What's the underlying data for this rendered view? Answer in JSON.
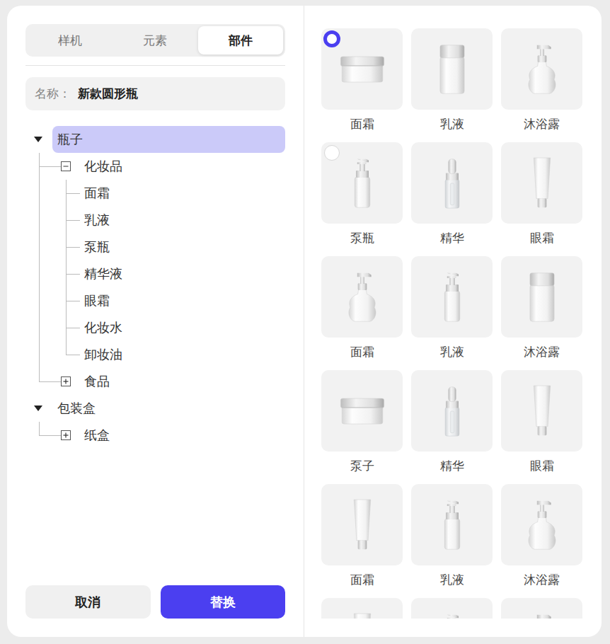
{
  "tabs": [
    {
      "label": "样机",
      "selected": false
    },
    {
      "label": "元素",
      "selected": false
    },
    {
      "label": "部件",
      "selected": true
    }
  ],
  "name_field": {
    "label": "名称：",
    "value": "新款圆形瓶"
  },
  "tree": [
    {
      "label": "瓶子",
      "kind": "group",
      "expanded": true,
      "selected": true,
      "children": [
        {
          "label": "化妆品",
          "kind": "folder",
          "expanded": true,
          "selected": false,
          "children": [
            {
              "label": "面霜",
              "kind": "leaf",
              "selected": false,
              "children": []
            },
            {
              "label": "乳液",
              "kind": "leaf",
              "selected": false,
              "children": []
            },
            {
              "label": "泵瓶",
              "kind": "leaf",
              "selected": false,
              "children": []
            },
            {
              "label": "精华液",
              "kind": "leaf",
              "selected": false,
              "children": []
            },
            {
              "label": "眼霜",
              "kind": "leaf",
              "selected": false,
              "children": []
            },
            {
              "label": "化妆水",
              "kind": "leaf",
              "selected": false,
              "children": []
            },
            {
              "label": "卸妆油",
              "kind": "leaf",
              "selected": false,
              "children": []
            }
          ]
        },
        {
          "label": "食品",
          "kind": "folder",
          "expanded": false,
          "selected": false,
          "children": []
        }
      ]
    },
    {
      "label": "包装盒",
      "kind": "group",
      "expanded": true,
      "selected": false,
      "children": [
        {
          "label": "纸盒",
          "kind": "folder",
          "expanded": false,
          "selected": false,
          "children": []
        }
      ]
    }
  ],
  "buttons": [
    {
      "label": "取消",
      "kind": "secondary"
    },
    {
      "label": "替换",
      "kind": "primary"
    }
  ],
  "grid": [
    {
      "label": "面霜",
      "kind": "jar",
      "selected": true,
      "radio_shown": true
    },
    {
      "label": "乳液",
      "kind": "bottle",
      "selected": false,
      "radio_shown": false
    },
    {
      "label": "沐浴露",
      "kind": "pump",
      "selected": false,
      "radio_shown": false
    },
    {
      "label": "泵瓶",
      "kind": "pumpbottle",
      "selected": false,
      "radio_shown": true
    },
    {
      "label": "精华",
      "kind": "dropper",
      "selected": false,
      "radio_shown": false
    },
    {
      "label": "眼霜",
      "kind": "tube",
      "selected": false,
      "radio_shown": false
    },
    {
      "label": "面霜",
      "kind": "pump",
      "selected": false,
      "radio_shown": false
    },
    {
      "label": "乳液",
      "kind": "pumpbottle",
      "selected": false,
      "radio_shown": false
    },
    {
      "label": "沐浴露",
      "kind": "bottle",
      "selected": false,
      "radio_shown": false
    },
    {
      "label": "泵子",
      "kind": "jar",
      "selected": false,
      "radio_shown": false
    },
    {
      "label": "精华",
      "kind": "dropper",
      "selected": false,
      "radio_shown": false
    },
    {
      "label": "眼霜",
      "kind": "tube",
      "selected": false,
      "radio_shown": false
    },
    {
      "label": "面霜",
      "kind": "tube",
      "selected": false,
      "radio_shown": false
    },
    {
      "label": "乳液",
      "kind": "pumpbottle",
      "selected": false,
      "radio_shown": false
    },
    {
      "label": "沐浴露",
      "kind": "pump",
      "selected": false,
      "radio_shown": false
    },
    {
      "kind": "tube",
      "selected": false,
      "radio_shown": false
    },
    {
      "kind": "pumpbottle",
      "selected": false,
      "radio_shown": false
    },
    {
      "kind": "pump",
      "selected": false,
      "radio_shown": false
    }
  ]
}
